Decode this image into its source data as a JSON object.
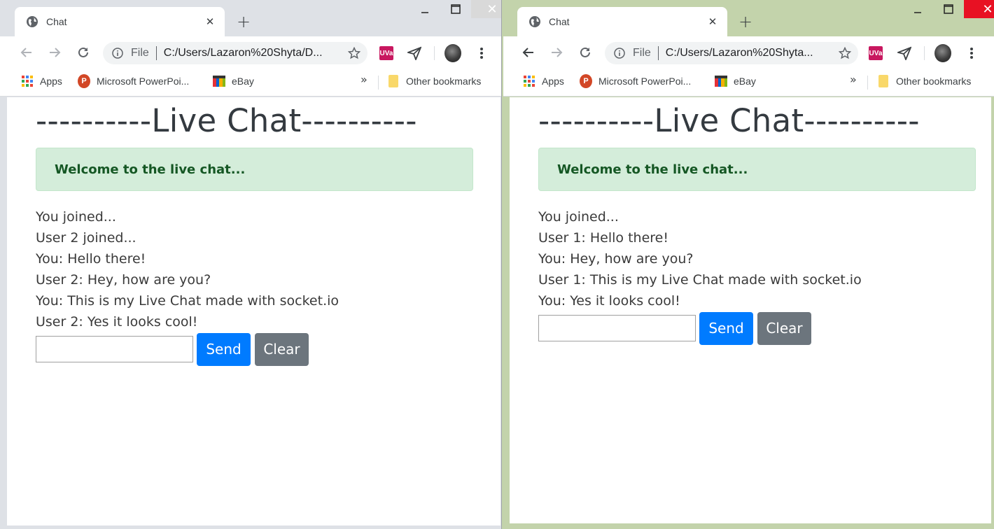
{
  "windows": [
    {
      "tab_title": "Chat",
      "omnibox": {
        "scheme": "File",
        "url": "C:/Users/Lazaron%20Shyta/D..."
      },
      "bookmarks": {
        "apps": "Apps",
        "powerpoint": "Microsoft PowerPoi...",
        "ebay": "eBay",
        "overflow": "»",
        "other": "Other bookmarks"
      },
      "page": {
        "title": "----------Live Chat----------",
        "alert": "Welcome to the live chat...",
        "messages": [
          "You joined...",
          "User 2 joined...",
          "You: Hello there!",
          "User 2: Hey, how are you?",
          "You: This is my Live Chat made with socket.io",
          "User 2: Yes it looks cool!"
        ],
        "input_value": "",
        "send_label": "Send",
        "clear_label": "Clear"
      }
    },
    {
      "tab_title": "Chat",
      "omnibox": {
        "scheme": "File",
        "url": "C:/Users/Lazaron%20Shyta..."
      },
      "bookmarks": {
        "apps": "Apps",
        "powerpoint": "Microsoft PowerPoi...",
        "ebay": "eBay",
        "overflow": "»",
        "other": "Other bookmarks"
      },
      "page": {
        "title": "----------Live Chat----------",
        "alert": "Welcome to the live chat...",
        "messages": [
          "You joined...",
          "User 1: Hello there!",
          "You: Hey, how are you?",
          "User 1: This is my Live Chat made with socket.io",
          "You: Yes it looks cool!"
        ],
        "input_value": "",
        "send_label": "Send",
        "clear_label": "Clear"
      }
    }
  ],
  "icons": {
    "favicon": "globe-icon",
    "tab_close": "close-icon",
    "new_tab": "plus-icon",
    "back": "arrow-left-icon",
    "forward": "arrow-right-icon",
    "reload": "reload-icon",
    "site_info": "info-icon",
    "bookmark_star": "star-icon",
    "extension_uva": "uva-extension-icon",
    "extension_send": "paper-plane-icon",
    "profile": "avatar",
    "menu": "kebab-menu-icon"
  },
  "colors": {
    "send_button": "#007bff",
    "clear_button": "#6c757d",
    "alert_bg": "#d4edda",
    "alert_text": "#155724",
    "close_active": "#e81123"
  }
}
